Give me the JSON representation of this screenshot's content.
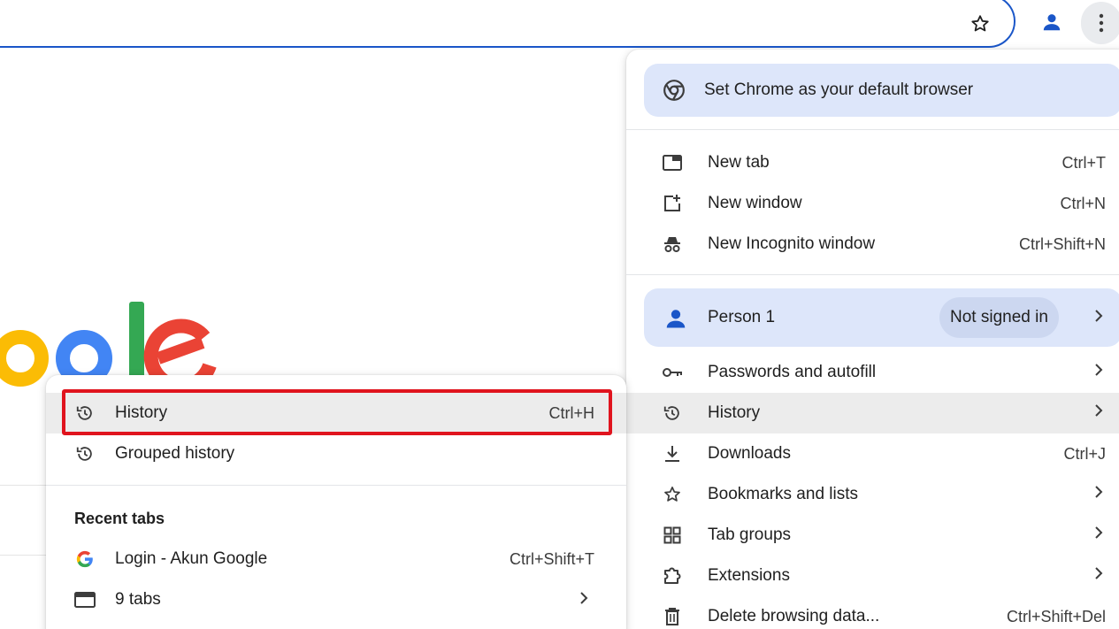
{
  "toolbar": {
    "bookmark_icon": "star-icon",
    "profile_icon": "person-icon",
    "menu_icon": "more-vert-icon",
    "accent_color": "#1a56c8"
  },
  "logo": {
    "text": "ogle",
    "colors": [
      "#fbbc05",
      "#4285f4",
      "#34a853",
      "#ea4335"
    ]
  },
  "main_menu": {
    "promo_label": "Set Chrome as your default browser",
    "items_group1": [
      {
        "label": "New tab",
        "shortcut": "Ctrl+T",
        "icon": "new-tab-icon"
      },
      {
        "label": "New window",
        "shortcut": "Ctrl+N",
        "icon": "new-window-icon"
      },
      {
        "label": "New Incognito window",
        "shortcut": "Ctrl+Shift+N",
        "icon": "incognito-icon"
      }
    ],
    "person": {
      "name": "Person 1",
      "status": "Not signed in"
    },
    "items_group2": [
      {
        "label": "Passwords and autofill",
        "shortcut": "",
        "icon": "key-icon",
        "submenu": true
      },
      {
        "label": "History",
        "shortcut": "",
        "icon": "history-icon",
        "submenu": true,
        "highlighted": true
      },
      {
        "label": "Downloads",
        "shortcut": "Ctrl+J",
        "icon": "download-icon"
      },
      {
        "label": "Bookmarks and lists",
        "shortcut": "",
        "icon": "star-icon",
        "submenu": true
      },
      {
        "label": "Tab groups",
        "shortcut": "",
        "icon": "tab-groups-icon",
        "submenu": true
      },
      {
        "label": "Extensions",
        "shortcut": "",
        "icon": "extension-icon",
        "submenu": true
      },
      {
        "label": "Delete browsing data...",
        "shortcut": "Ctrl+Shift+Del",
        "icon": "trash-icon"
      }
    ]
  },
  "history_submenu": {
    "items": [
      {
        "label": "History",
        "shortcut": "Ctrl+H",
        "icon": "history-icon"
      },
      {
        "label": "Grouped history",
        "shortcut": "",
        "icon": "history-icon"
      }
    ],
    "recent_header": "Recent tabs",
    "recent_items": [
      {
        "label": "Login - Akun Google",
        "shortcut": "Ctrl+Shift+T",
        "icon": "google-g-icon"
      },
      {
        "label": "9 tabs",
        "shortcut": "",
        "icon": "tab-window-icon",
        "submenu": true
      }
    ],
    "highlight_color": "#e0141e"
  }
}
